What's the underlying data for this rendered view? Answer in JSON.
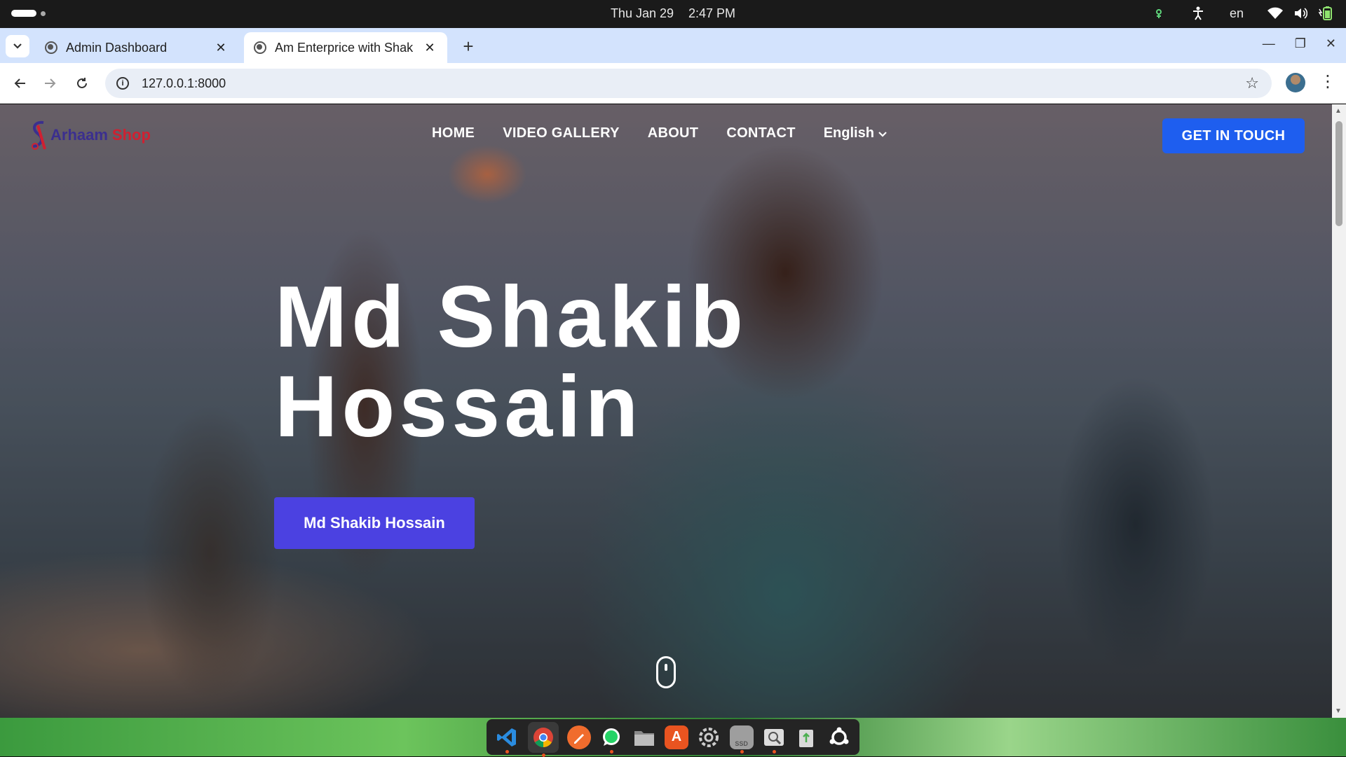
{
  "os": {
    "date": "Thu Jan 29",
    "time": "2:47 PM",
    "lang": "en",
    "icons": [
      "accessibility-icon",
      "wifi-icon",
      "volume-icon",
      "battery-icon"
    ]
  },
  "browser": {
    "tabs": [
      {
        "label": "Admin Dashboard",
        "active": false
      },
      {
        "label": "Am Enterprice with Shak",
        "active": true
      }
    ],
    "url": "127.0.0.1:8000"
  },
  "site": {
    "logo_part1": "Arhaam",
    "logo_part2": "Shop",
    "nav": [
      "HOME",
      "VIDEO GALLERY",
      "ABOUT",
      "CONTACT"
    ],
    "language": "English",
    "cta": "GET IN TOUCH",
    "hero_line1": "Md Shakib",
    "hero_line2": "Hossain",
    "hero_button": "Md Shakib Hossain"
  },
  "dock": {
    "apps": [
      "vscode",
      "chrome",
      "text-editor",
      "whatsapp",
      "files",
      "app-center",
      "settings",
      "ssd",
      "image-viewer",
      "trash",
      "ubuntu"
    ],
    "ssd_label": "SSD"
  },
  "colors": {
    "cta": "#1e5eef",
    "hero_button": "#4b41e1",
    "tab_strip": "#d3e3fd"
  }
}
